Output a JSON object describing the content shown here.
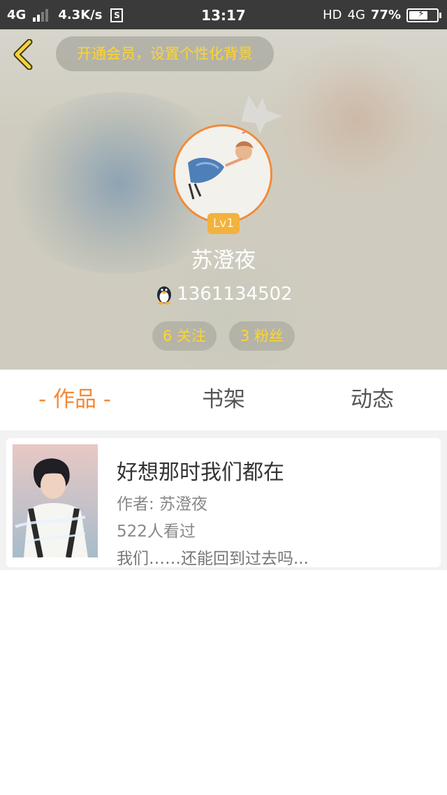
{
  "status_bar": {
    "network": "4G",
    "speed": "4.3K/s",
    "s_icon": "S",
    "time": "13:17",
    "hd": "HD",
    "network_right": "4G",
    "battery": "77%",
    "battery_level": 0.77
  },
  "header": {
    "vip_prompt": "开通会员，设置个性化背景",
    "level": "Lv1",
    "username": "苏澄夜",
    "qq_number": "1361134502",
    "follows": "6 关注",
    "fans": "3 粉丝"
  },
  "tabs": [
    {
      "label": "- 作品 -",
      "active": true
    },
    {
      "label": "书架",
      "active": false
    },
    {
      "label": "动态",
      "active": false
    }
  ],
  "works": [
    {
      "title": "好想那时我们都在",
      "author": "作者: 苏澄夜",
      "views": "522人看过",
      "intro": "我们……还能回到过去吗..."
    }
  ],
  "colors": {
    "accent": "#f28a3a",
    "highlight": "#ffd62b",
    "badge": "#f3b13d"
  },
  "icons": {
    "back": "back-arrow-icon",
    "qq": "penguin-icon",
    "crown": "crown-icon"
  }
}
